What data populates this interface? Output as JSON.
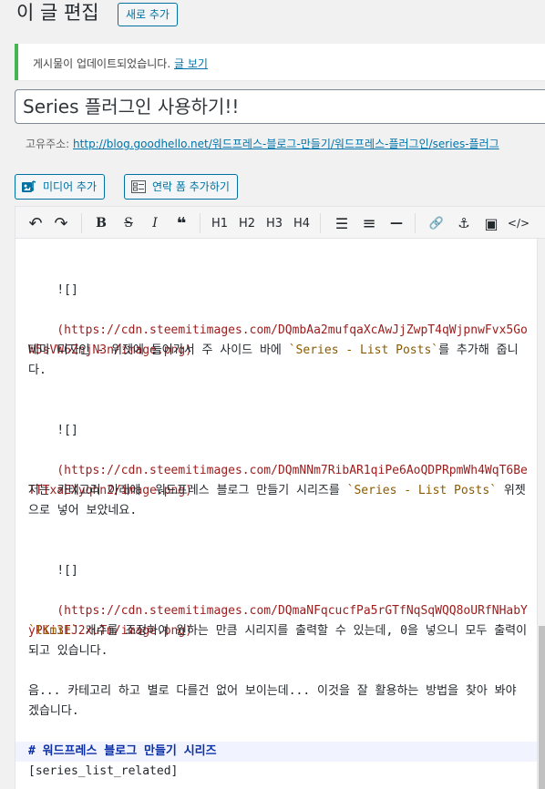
{
  "header": {
    "title": "이 글 편집",
    "add_new_label": "새로 추가"
  },
  "notice": {
    "text": "게시물이 업데이트되었습니다.",
    "link": "글 보기"
  },
  "post": {
    "title": "Series 플러그인 사용하기!!"
  },
  "permalink": {
    "label": "고유주소:",
    "url": "http://blog.goodhello.net/워드프레스-블로그-만들기/워드프레스-플러그인/series-플러그"
  },
  "media_buttons": {
    "media_label": "미디어 추가",
    "contact_label": "연락 폼 추가하기"
  },
  "toolbar": {
    "undo": "↶",
    "redo": "↷",
    "bold": "B",
    "strike": "S",
    "italic": "I",
    "quote": "❝",
    "h1": "H1",
    "h2": "H2",
    "h3": "H3",
    "h4": "H4",
    "ul": "☰",
    "ol": "≡",
    "hr": "—",
    "link": "🔗",
    "anchor": "⚓",
    "image": "▣",
    "code": "</>"
  },
  "content": {
    "img1_bang": "![]",
    "img1_url": "(https://cdn.steemitimages.com/DQmbAa2mufqaXcAwJjZwpT4qWjpnwFvx5GoW5sVW6ZnjN3n/image.png)",
    "p1_a": "테마 디자인 - 위젯에 들어가서 주 사이드 바에 ",
    "p1_code": "`Series - List Posts`",
    "p1_b": "를 추가해 줍니다.",
    "img2_bang": "![]",
    "img2_url": "(https://cdn.steemitimages.com/DQmNNm7RibAR1qiPe6AoQDPRpmWh4WqT6BeTTTxaEXyqhn2/image.png)",
    "p2_a": "저는 카테고리 아래에  워드프레스 블로그 만들기 시리즈를 ",
    "p2_code": "`Series - List Posts`",
    "p2_b": " 위젯으로 넣어 보았네요.",
    "img3_bang": "![]",
    "img3_url": "(https://cdn.steemitimages.com/DQmaNFqcucfPa5rGTfNqSqWQQ8oURfNHabYyPKi3EJ2xuTm/image.png)",
    "p3_code": "`limit`",
    "p3_b": " 개수를 조정하여 원하는 만큼 시리지를 출력할 수 있는데, 0을 넣으니 모두 출력이 되고 있습니다.",
    "p4": "음... 카테고리 하고 별로 다를건 없어 보이는데... 이것을 잘 활용하는 방법을 찾아 봐야 겠습니다.",
    "heading": "# 워드프레스 블로그 만들기 시리즈",
    "shortcode": "[series_list_related]"
  }
}
